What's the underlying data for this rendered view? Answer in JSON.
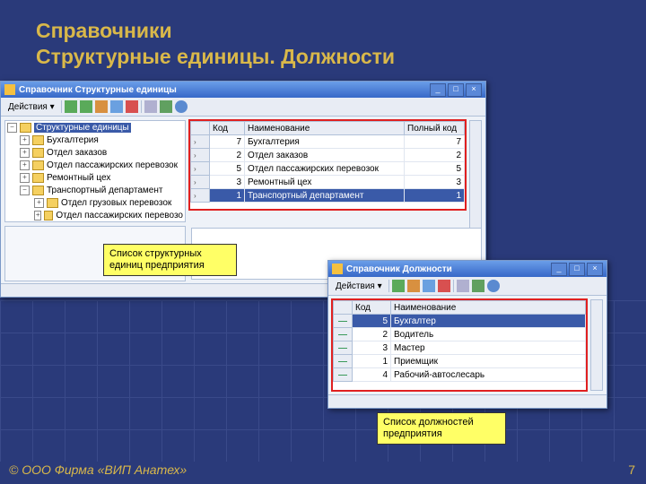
{
  "slide": {
    "title_line1": "Справочники",
    "title_line2": "Структурные единицы. Должности",
    "footer": "© ООО Фирма «ВИП Анатех»",
    "page": "7"
  },
  "callouts": {
    "c1": "Список структурных единиц предприятия",
    "c2": "Список должностей предприятия"
  },
  "win1": {
    "title": "Справочник Структурные единицы",
    "menu": "Действия ▾",
    "btn_min": "_",
    "btn_max": "□",
    "btn_close": "×",
    "tree": {
      "root": "Структурные единицы",
      "n1": "Бухгалтерия",
      "n2": "Отдел заказов",
      "n3": "Отдел пассажирских перевозок",
      "n4": "Ремонтный цех",
      "n5": "Транспортный департамент",
      "n5a": "Отдел грузовых перевозок",
      "n5b": "Отдел пассажирских перевозо"
    },
    "grid": {
      "h_code": "Код",
      "h_name": "Наименование",
      "h_full": "Полный код",
      "rows": [
        {
          "code": "7",
          "name": "Бухгалтерия",
          "full": "7"
        },
        {
          "code": "2",
          "name": "Отдел заказов",
          "full": "2"
        },
        {
          "code": "5",
          "name": "Отдел пассажирских перевозок",
          "full": "5"
        },
        {
          "code": "3",
          "name": "Ремонтный цех",
          "full": "3"
        },
        {
          "code": "1",
          "name": "Транспортный департамент",
          "full": "1"
        }
      ]
    }
  },
  "win2": {
    "title": "Справочник Должности",
    "menu": "Действия ▾",
    "btn_min": "_",
    "btn_max": "□",
    "btn_close": "×",
    "grid": {
      "h_code": "Код",
      "h_name": "Наименование",
      "rows": [
        {
          "code": "5",
          "name": "Бухгалтер"
        },
        {
          "code": "2",
          "name": "Водитель"
        },
        {
          "code": "3",
          "name": "Мастер"
        },
        {
          "code": "1",
          "name": "Приемщик"
        },
        {
          "code": "4",
          "name": "Рабочий-автослесарь"
        }
      ]
    }
  }
}
